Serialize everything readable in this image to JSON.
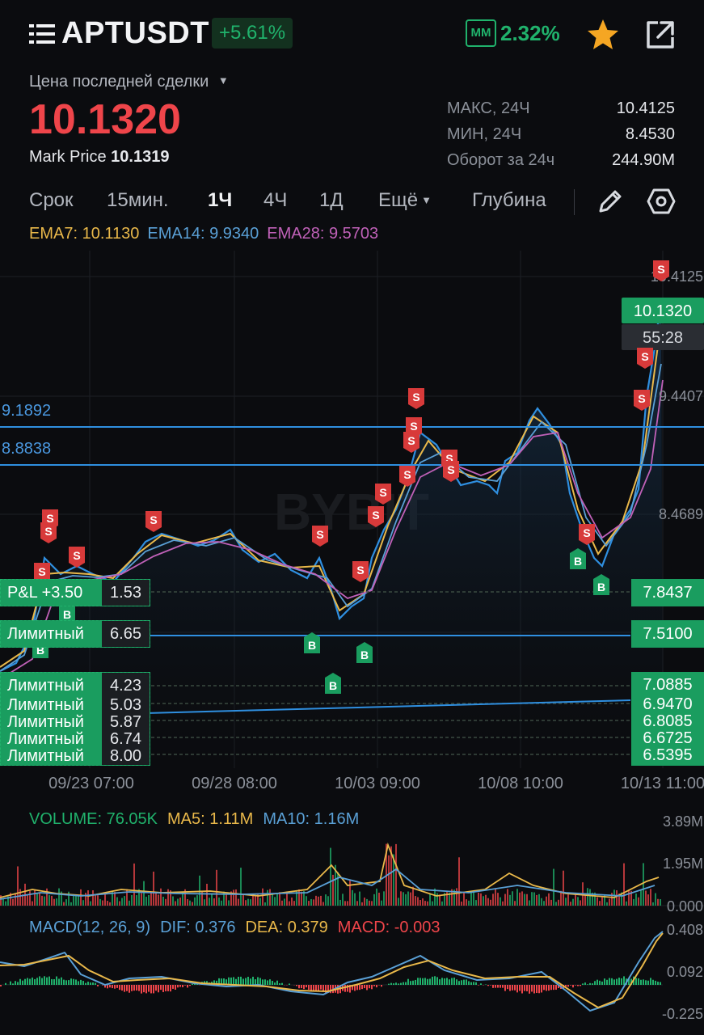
{
  "header": {
    "symbol": "APTUSDT",
    "change_pct": "+5.61%",
    "mm_label": "MM",
    "mm_value": "2.32%",
    "last_trade_label": "Цена последней сделки",
    "last_price": "10.1320",
    "mark_price_label": "Mark Price",
    "mark_price_value": "10.1319",
    "stats": [
      {
        "label": "МАКС, 24Ч",
        "value": "10.4125"
      },
      {
        "label": "МИН, 24Ч",
        "value": "8.4530"
      },
      {
        "label": "Оборот за 24ч",
        "value": "244.90M"
      }
    ]
  },
  "toolbar": {
    "items": [
      "Срок",
      "15мин.",
      "1Ч",
      "4Ч",
      "1Д",
      "Ещё",
      "Глубина"
    ],
    "active": "1Ч"
  },
  "ema": [
    {
      "label": "EMA7: 10.1130",
      "color": "#e9b84a"
    },
    {
      "label": "EMA14: 9.9340",
      "color": "#5aa0d6"
    },
    {
      "label": "EMA28: 9.5703",
      "color": "#c061b8"
    }
  ],
  "main_chart": {
    "watermark": "BYBIT",
    "y_axis_labels": [
      "10.4125",
      "9.4407",
      "8.4689"
    ],
    "current_price_tag": "10.1320",
    "countdown": "55:28",
    "h_lines": [
      {
        "label": "9.1892"
      },
      {
        "label": "8.8838"
      }
    ],
    "x_axis_labels": [
      "09/23 07:00",
      "09/28 08:00",
      "10/03 09:00",
      "10/08 10:00",
      "10/13 11:00"
    ],
    "order_tags": [
      {
        "label": "P&L +3.50",
        "qty": "1.53",
        "price": "7.8437"
      },
      {
        "label": "Лимитный",
        "qty": "6.65",
        "price": "7.5100"
      },
      {
        "label": "Лимитный",
        "qty": "4.23",
        "price": "7.0885"
      },
      {
        "label": "Лимитный",
        "qty": "5.03",
        "price": "6.9470"
      },
      {
        "label": "Лимитный",
        "qty": "5.87",
        "price": "6.8085"
      },
      {
        "label": "Лимитный",
        "qty": "6.74",
        "price": "6.6725"
      },
      {
        "label": "Лимитный",
        "qty": "8.00",
        "price": "6.5395"
      }
    ],
    "sell_marker": "S",
    "buy_marker": "B"
  },
  "volume": {
    "labels": [
      {
        "text": "VOLUME: 76.05K",
        "color": "#20b26c"
      },
      {
        "text": "MA5: 1.11M",
        "color": "#e9b84a"
      },
      {
        "text": "MA10: 1.16M",
        "color": "#5aa0d6"
      }
    ],
    "axis": [
      "3.89M",
      "1.95M",
      "0.000"
    ]
  },
  "macd": {
    "labels": [
      {
        "text": "MACD(12, 26, 9)",
        "color": "#5aa0d6"
      },
      {
        "text": "DIF: 0.376",
        "color": "#5aa0d6"
      },
      {
        "text": "DEA: 0.379",
        "color": "#e9b84a"
      },
      {
        "text": "MACD: -0.003",
        "color": "#ef454a"
      }
    ],
    "axis": [
      "0.408",
      "0.092",
      "-0.225"
    ]
  },
  "colors": {
    "up": "#20b26c",
    "down": "#ef454a",
    "line": "#2f8fe0",
    "bg": "#0b0c0f"
  }
}
